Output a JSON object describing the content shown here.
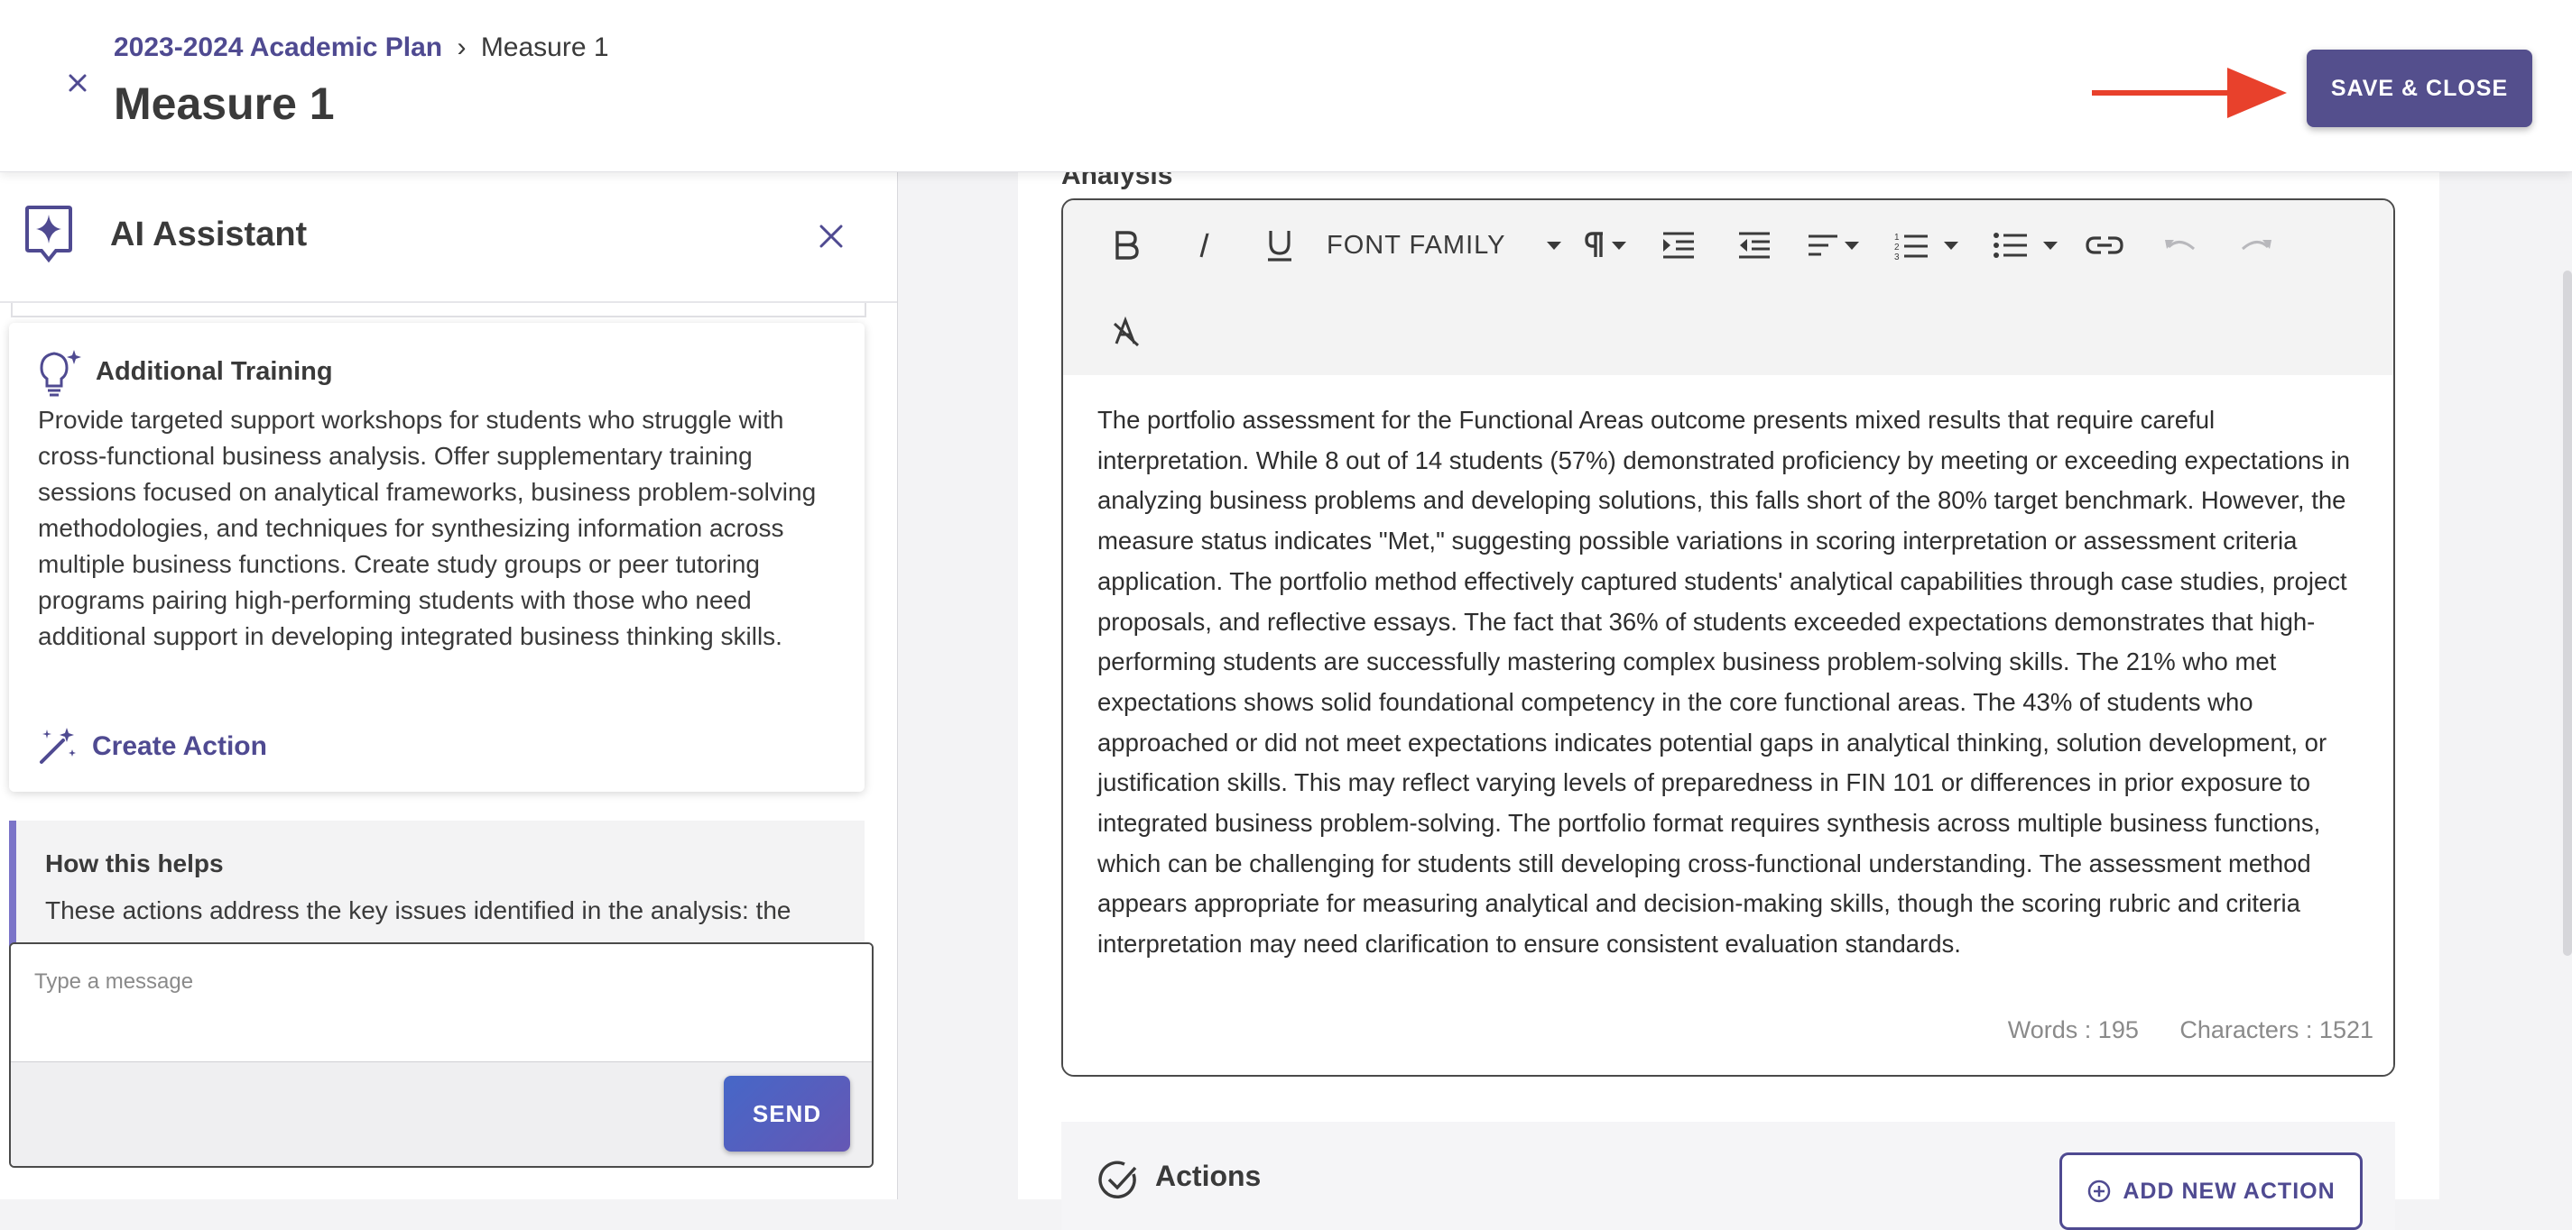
{
  "header": {
    "breadcrumb_link": "2023-2024 Academic Plan",
    "breadcrumb_separator": "›",
    "breadcrumb_current": "Measure 1",
    "title": "Measure 1",
    "save_close_label": "SAVE & CLOSE"
  },
  "ai_assistant": {
    "title": "AI Assistant",
    "suggestion": {
      "title": "Additional Training",
      "text": "Provide targeted support workshops for students who struggle with cross-functional business analysis. Offer supplementary training sessions focused on analytical frameworks, business problem-solving methodologies, and techniques for synthesizing information across multiple business functions. Create study groups or peer tutoring programs pairing high-performing students with those who need additional support in developing integrated business thinking skills.",
      "create_action_label": "Create Action"
    },
    "how_helps": {
      "title": "How this helps",
      "text": "These actions address the key issues identified in the analysis: the"
    },
    "message_placeholder": "Type a message",
    "send_label": "SEND"
  },
  "editor": {
    "section_label": "Analysis",
    "font_family_label": "FONT FAMILY",
    "body": "The portfolio assessment for the Functional Areas outcome presents mixed results that require careful interpretation. While 8 out of 14 students (57%) demonstrated proficiency by meeting or exceeding expectations in analyzing business problems and developing solutions, this falls short of the 80% target benchmark. However, the measure status indicates \"Met,\" suggesting possible variations in scoring interpretation or assessment criteria application. The portfolio method effectively captured students' analytical capabilities through case studies, project proposals, and reflective essays. The fact that 36% of students exceeded expectations demonstrates that high-performing students are successfully mastering complex business problem-solving skills. The 21% who met expectations shows solid foundational competency in the core functional areas. The 43% of students who approached or did not meet expectations indicates potential gaps in analytical thinking, solution development, or justification skills. This may reflect varying levels of preparedness in FIN 101 or differences in prior exposure to integrated business problem-solving. The portfolio format requires synthesis across multiple business functions, which can be challenging for students still developing cross-functional understanding. The assessment method appears appropriate for measuring analytical and decision-making skills, though the scoring rubric and criteria interpretation may need clarification to ensure consistent evaluation standards.",
    "words_label": "Words : 195",
    "characters_label": "Characters : 1521"
  },
  "actions": {
    "title": "Actions",
    "add_new_label": "ADD NEW ACTION"
  },
  "colors": {
    "brand": "#544f8d",
    "link": "#4f4a91",
    "arrow": "#e8412c",
    "send_gradient_start": "#4667c8",
    "send_gradient_end": "#6557b4"
  },
  "icons": {
    "header_close": "close-icon",
    "ai_logo": "sparkle-chat-icon",
    "ai_close": "close-icon",
    "suggestion": "lightbulb-icon",
    "create_action": "magic-wand-icon",
    "toolbar": [
      "bold-icon",
      "italic-icon",
      "underline-icon",
      "font-family-dropdown",
      "paragraph-icon",
      "indent-icon",
      "outdent-icon",
      "align-icon",
      "numbered-list-icon",
      "bullet-list-icon",
      "link-icon",
      "undo-icon",
      "redo-icon",
      "clear-format-icon"
    ],
    "actions": "check-circle-icon",
    "add_action": "plus-circle-icon"
  }
}
